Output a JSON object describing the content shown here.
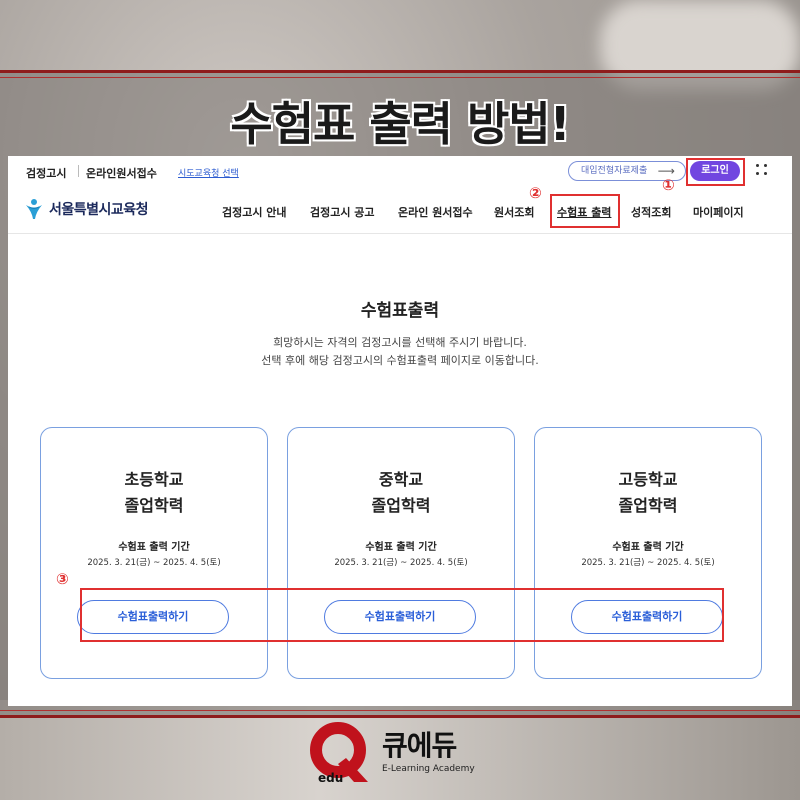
{
  "headline": "수험표 출력 방법!",
  "util": {
    "link1": "검정고시",
    "link2": "온라인원서접수",
    "region_select": "시도교육청 선택",
    "apply_button": "대입전형자료제출",
    "login_button": "로그인"
  },
  "nav": {
    "logo_name": "서울특별시교육청",
    "menu": [
      "검정고시 안내",
      "검정고시 공고",
      "온라인 원서접수",
      "원서조회",
      "수험표 출력",
      "성적조회",
      "마이페이지"
    ]
  },
  "annotations": {
    "step1": "①",
    "step2": "②",
    "step3": "③"
  },
  "content": {
    "title": "수험표출력",
    "desc1": "희망하시는 자격의 검정고시를 선택해 주시기 바랍니다.",
    "desc2": "선택 후에 해당 검정고시의 수험표출력 페이지로 이동합니다."
  },
  "cards": [
    {
      "line1": "초등학교",
      "line2": "졸업학력",
      "period_label": "수험표 출력 기간",
      "period": "2025. 3. 21(금) ~ 2025. 4. 5(토)",
      "button": "수험표출력하기"
    },
    {
      "line1": "중학교",
      "line2": "졸업학력",
      "period_label": "수험표 출력 기간",
      "period": "2025. 3. 21(금) ~ 2025. 4. 5(토)",
      "button": "수험표출력하기"
    },
    {
      "line1": "고등학교",
      "line2": "졸업학력",
      "period_label": "수험표 출력 기간",
      "period": "2025. 3. 21(금) ~ 2025. 4. 5(토)",
      "button": "수험표출력하기"
    }
  ],
  "brand": {
    "name": "큐에듀",
    "sub": "E-Learning Academy",
    "logo_text": "edu"
  },
  "colors": {
    "accent_red": "#e03030",
    "login_purple": "#7146e0",
    "link_blue": "#2b5fd8",
    "brand_red": "#c0121c"
  }
}
